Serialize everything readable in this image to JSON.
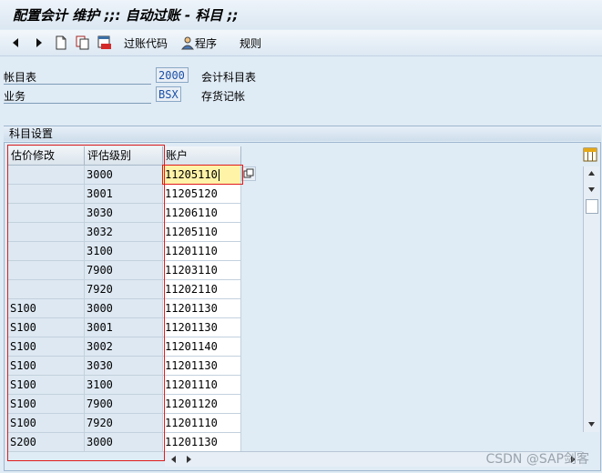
{
  "window": {
    "title": "配置会计 维护 ;;: 自动过账 - 科目 ;;"
  },
  "toolbar": {
    "posting_key_label": "过账代码",
    "procedures_label": "程序",
    "rules_label": "规则"
  },
  "form": {
    "coa_label": "帐目表",
    "coa_value": "2000",
    "coa_desc": "会计科目表",
    "transaction_label": "业务",
    "transaction_value": "BSX",
    "transaction_desc": "存货记帐"
  },
  "section": {
    "title": "科目设置"
  },
  "table": {
    "columns": [
      "估价修改",
      "评估级别",
      "账户"
    ],
    "rows": [
      {
        "mod": "",
        "class": "3000",
        "account": "11205110"
      },
      {
        "mod": "",
        "class": "3001",
        "account": "11205120"
      },
      {
        "mod": "",
        "class": "3030",
        "account": "11206110"
      },
      {
        "mod": "",
        "class": "3032",
        "account": "11205110"
      },
      {
        "mod": "",
        "class": "3100",
        "account": "11201110"
      },
      {
        "mod": "",
        "class": "7900",
        "account": "11203110"
      },
      {
        "mod": "",
        "class": "7920",
        "account": "11202110"
      },
      {
        "mod": "S100",
        "class": "3000",
        "account": "11201130"
      },
      {
        "mod": "S100",
        "class": "3001",
        "account": "11201130"
      },
      {
        "mod": "S100",
        "class": "3002",
        "account": "11201140"
      },
      {
        "mod": "S100",
        "class": "3030",
        "account": "11201130"
      },
      {
        "mod": "S100",
        "class": "3100",
        "account": "11201110"
      },
      {
        "mod": "S100",
        "class": "7900",
        "account": "11201120"
      },
      {
        "mod": "S100",
        "class": "7920",
        "account": "11201110"
      },
      {
        "mod": "S200",
        "class": "3000",
        "account": "11201130"
      }
    ]
  },
  "watermark": "CSDN @SAP剑客",
  "colors": {
    "highlight": "#fff3a8",
    "annotation_box": "#e01b1b",
    "background": "#dfebf5"
  }
}
